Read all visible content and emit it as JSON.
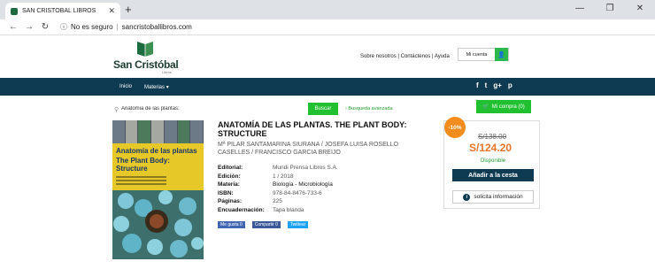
{
  "browser": {
    "tab_title": "SAN CRISTOBAL LIBROS",
    "insecure_label": "No es seguro",
    "url": "sancristoballibros.com"
  },
  "header": {
    "brand": "San Cristóbal",
    "brand_sub": "Libros",
    "links": [
      "Sobre nosotros",
      "Contáctenos",
      "Ayuda"
    ],
    "account_label": "Mi cuenta"
  },
  "nav": {
    "items": [
      "Inicio",
      "Materias ▾"
    ],
    "social": [
      "f",
      "t",
      "g+",
      "p"
    ]
  },
  "search": {
    "value": "Anatomia de las plantas:",
    "button": "Buscar",
    "advanced": "› Busqueda avanzada",
    "cart": "Mi compra (0)"
  },
  "cover": {
    "title_a": "Anatomía de las plantas",
    "title_b": "The Plant Body: Structure"
  },
  "product": {
    "title": "ANATOMÍA DE LAS PLANTAS. THE PLANT BODY: STRUCTURE",
    "authors": "Mª PILAR SANTAMARINA SIURANA / JOSEFA LUISA ROSELLO CASELLES / FRANCISCO GARCIA BREIJO",
    "attributes": [
      {
        "key": "Editorial:",
        "value": "Mundi Prensa Libros S.A."
      },
      {
        "key": "Edición:",
        "value": "1 / 2018"
      },
      {
        "key": "Materia:",
        "value": "Biología - Microbiología"
      },
      {
        "key": "ISBN:",
        "value": "978-84-8476-733-6"
      },
      {
        "key": "Páginas:",
        "value": "225"
      },
      {
        "key": "Encuadernación:",
        "value": "Tapa blanda"
      }
    ],
    "share": [
      "Me gusta 0",
      "Compartir 0",
      "Twittear"
    ]
  },
  "pricing": {
    "discount": "-10%",
    "old_price": "S/138.00",
    "new_price": "S/124.20",
    "availability": "Disponible",
    "add_to_cart": "Añadir a la cesta",
    "request_info": "solicita información"
  }
}
